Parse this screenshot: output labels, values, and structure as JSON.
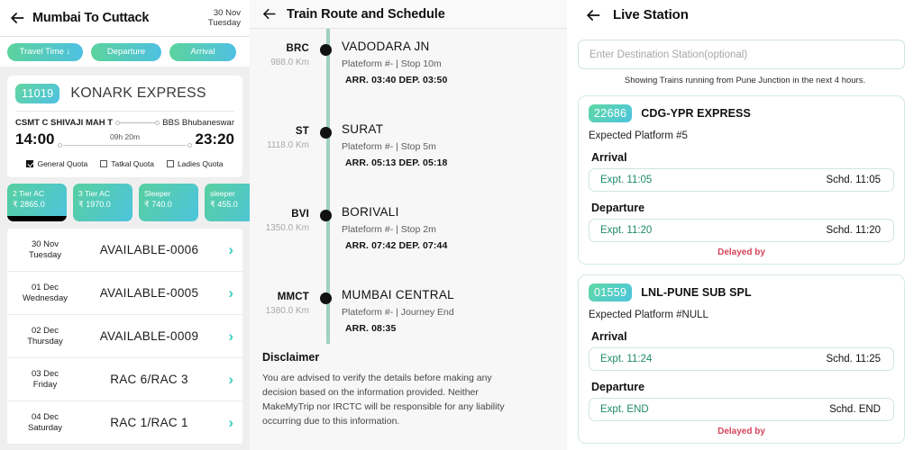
{
  "panel1": {
    "back_icon": "back-arrow-icon",
    "title": "Mumbai To Cuttack",
    "date_line1": "30 Nov",
    "date_line2": "Tuesday",
    "filters": [
      {
        "label": "Travel Time ↓"
      },
      {
        "label": "Departure"
      },
      {
        "label": "Arrival"
      }
    ],
    "train": {
      "number": "11019",
      "name": "KONARK EXPRESS",
      "from_station": "CSMT C SHIVAJI MAH T",
      "to_station": "BBS Bhubaneswar",
      "depart_time": "14:00",
      "arrive_time": "23:20",
      "duration": "09h 20m",
      "quotas": [
        {
          "label": "General Quota",
          "checked": true
        },
        {
          "label": "Tatkal Quota",
          "checked": false
        },
        {
          "label": "Ladies Quota",
          "checked": false
        }
      ],
      "fares": [
        {
          "class": "2 Tier AC",
          "price": "₹ 2865.0",
          "selected": true
        },
        {
          "class": "3 Tier AC",
          "price": "₹ 1970.0",
          "selected": false
        },
        {
          "class": "Sleeper",
          "price": "₹ 740.0",
          "selected": false
        },
        {
          "class": "sleeper",
          "price": "₹ 455.0",
          "selected": false
        }
      ],
      "availability": [
        {
          "date": "30 Nov",
          "day": "Tuesday",
          "status": "AVAILABLE-0006"
        },
        {
          "date": "01 Dec",
          "day": "Wednesday",
          "status": "AVAILABLE-0005"
        },
        {
          "date": "02 Dec",
          "day": "Thursday",
          "status": "AVAILABLE-0009"
        },
        {
          "date": "03 Dec",
          "day": "Friday",
          "status": "RAC  6/RAC  3"
        },
        {
          "date": "04 Dec",
          "day": "Saturday",
          "status": "RAC  1/RAC  1"
        }
      ]
    }
  },
  "panel2": {
    "back_icon": "back-arrow-icon",
    "title": "Train Route and Schedule",
    "stops": [
      {
        "code": "BRC",
        "km": "988.0 Km",
        "name": "VADODARA JN",
        "platform": "Plateform #- | Stop 10m",
        "times": "ARR. 03:40   DEP. 03:50"
      },
      {
        "code": "ST",
        "km": "1118.0 Km",
        "name": "SURAT",
        "platform": "Plateform #- | Stop 5m",
        "times": "ARR. 05:13   DEP. 05:18"
      },
      {
        "code": "BVI",
        "km": "1350.0 Km",
        "name": "BORIVALI",
        "platform": "Plateform #- | Stop 2m",
        "times": "ARR. 07:42   DEP. 07:44"
      },
      {
        "code": "MMCT",
        "km": "1380.0 Km",
        "name": "MUMBAI CENTRAL",
        "platform": "Plateform #- | Journey End",
        "times": "ARR. 08:35"
      }
    ],
    "disclaimer_title": "Disclaimer",
    "disclaimer_body": "You are advised to verify the details before making any decision based on the information provided. Neither MakeMyTrip nor IRCTC will be responsible for any liability occurring due to this information."
  },
  "panel3": {
    "back_icon": "back-arrow-icon",
    "title": "Live Station",
    "destination_placeholder": "Enter Destination Station(optional)",
    "destination_value": "",
    "showing_note": "Showing Trains running from Pune Junction in the next 4 hours.",
    "cards": [
      {
        "number": "22686",
        "name": "CDG-YPR EXPRESS",
        "platform": "Expected Platform #5",
        "arrival_label": "Arrival",
        "arrival_expected": "Expt. 11:05",
        "arrival_scheduled": "Schd. 11:05",
        "departure_label": "Departure",
        "departure_expected": "Expt. 11:20",
        "departure_scheduled": "Schd. 11:20",
        "delayed": "Delayed by"
      },
      {
        "number": "01559",
        "name": "LNL-PUNE SUB SPL",
        "platform": "Expected Platform #NULL",
        "arrival_label": "Arrival",
        "arrival_expected": "Expt. 11:24",
        "arrival_scheduled": "Schd. 11:25",
        "departure_label": "Departure",
        "departure_expected": "Expt. END",
        "departure_scheduled": "Schd. END",
        "delayed": "Delayed by"
      }
    ]
  },
  "colors": {
    "accent_green": "#5cd39d",
    "accent_blue": "#4ec0e2",
    "chevron": "#3ecfc0",
    "route_line": "#9fcfc2",
    "delay_red": "#d5455c",
    "expected_green": "#1e8a6b"
  }
}
